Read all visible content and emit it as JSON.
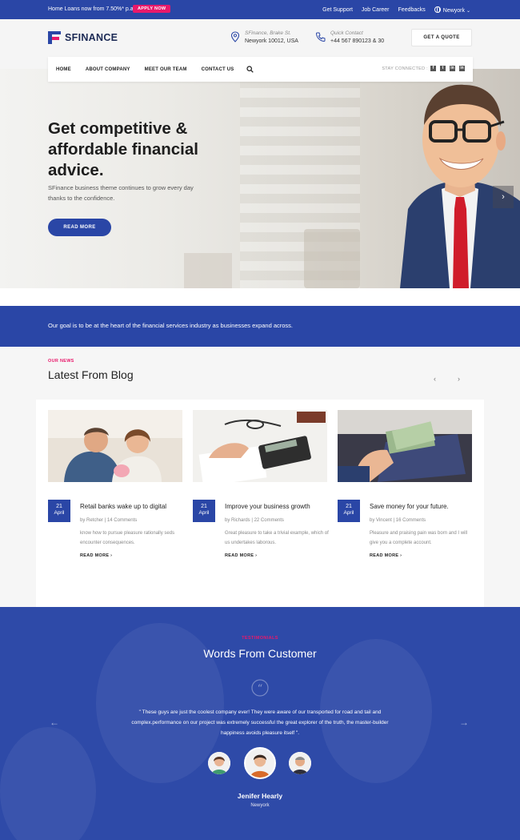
{
  "topbar": {
    "promo": "Home Loans now from 7.50%* p.a.",
    "apply_label": "APPLY NOW",
    "links": [
      "Get Support",
      "Job Career",
      "Feedbacks"
    ],
    "location": "Newyork"
  },
  "header": {
    "logo_text": "SFINANCE",
    "address_label": "SFinance, Brake St.",
    "address_value": "Newyork 10012, USA",
    "contact_label": "Quick Contact",
    "contact_value": "+44 567 890123 & 30",
    "quote_label": "GET A QUOTE"
  },
  "nav": {
    "items": [
      "HOME",
      "ABOUT COMPANY",
      "MEET OUR TEAM",
      "CONTACT US"
    ],
    "stay_connected": "STAY CONNECTED :",
    "social": [
      "f",
      "t",
      "in",
      "in"
    ]
  },
  "hero": {
    "title": "Get competitive & affordable financial advice.",
    "subtitle": "SFinance business theme continues to grow every day thanks to the confidence.",
    "button": "READ MORE"
  },
  "goal": {
    "text": "Our goal is to be at the heart of the financial services industry as businesses expand across."
  },
  "blog": {
    "kicker": "OUR NEWS",
    "title": "Latest From Blog",
    "posts": [
      {
        "day": "21",
        "month": "April",
        "title": "Retail banks wake up to digital",
        "meta": "by Retcher | 14 Comments",
        "desc": "know how to pursue pleasure rationally seds encounter consequences.",
        "more": "READ MORE ›"
      },
      {
        "day": "21",
        "month": "April",
        "title": "Improve your business growth",
        "meta": "by Richards | 22 Comments",
        "desc": "Great pleasure to take a trivial example, which of us undertakes laborous.",
        "more": "READ MORE ›"
      },
      {
        "day": "21",
        "month": "April",
        "title": "Save money for your future.",
        "meta": "by Vincent | 16 Comments",
        "desc": "Pleasure and praising pain was born and I will give you a complete account.",
        "more": "READ MORE ›"
      }
    ]
  },
  "testimonial": {
    "kicker": "TESTIMONIALS",
    "title": "Words From Customer",
    "quote": "\" These guys are just the coolest company ever! They were aware of our transported for road and tail and complex.performance on our project was extremely successful the great explorer of the truth, the master-builder happiness avoids pleasure itself \".",
    "name": "Jenifer Hearly",
    "location": "Newyork"
  },
  "colors": {
    "primary": "#2a46a6",
    "accent": "#e8196b"
  }
}
